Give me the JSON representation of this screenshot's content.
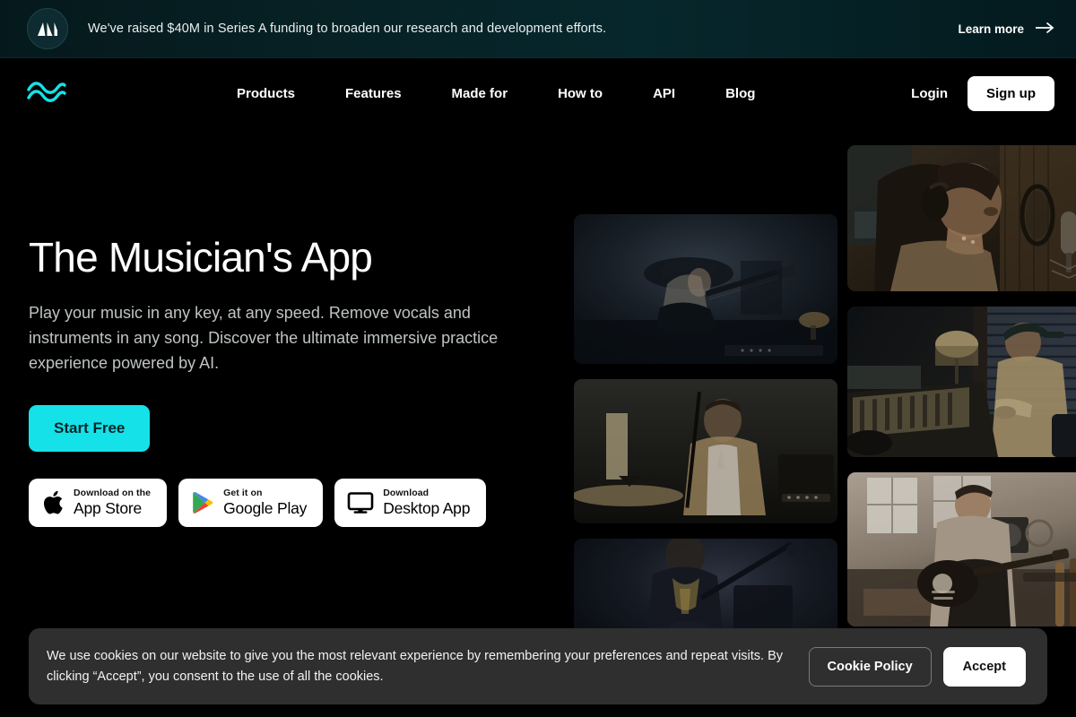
{
  "announcement": {
    "logo_icon": "mountain-monogram-logo-icon",
    "message": "We've raised $40M in Series A funding to broaden our research and development efforts.",
    "cta_label": "Learn more",
    "cta_icon": "arrow-right-icon",
    "bg_color": "#06272c"
  },
  "nav": {
    "logo_icon": "soundwave-logo-icon",
    "logo_color": "#15e2e8",
    "links": [
      {
        "label": "Products"
      },
      {
        "label": "Features"
      },
      {
        "label": "Made for"
      },
      {
        "label": "How to"
      },
      {
        "label": "API"
      },
      {
        "label": "Blog"
      }
    ],
    "login_label": "Login",
    "signup_label": "Sign up"
  },
  "hero": {
    "title": "The Musician's App",
    "subtitle": "Play your music in any key, at any speed. Remove vocals and instruments in any song. Discover the ultimate immersive practice experience powered by AI.",
    "cta_label": "Start Free",
    "cta_color": "#15e2e8",
    "stores": [
      {
        "icon": "apple-logo-icon",
        "top_label": "Download on the",
        "main_label": "App Store"
      },
      {
        "icon": "google-play-logo-icon",
        "top_label": "Get it on",
        "main_label": "Google Play"
      },
      {
        "icon": "desktop-monitor-icon",
        "top_label": "Download",
        "main_label": "Desktop App"
      }
    ]
  },
  "gallery": {
    "middle_column": [
      {
        "alt": "Guitarist wearing a hat playing electric guitar on a dark smoky stage"
      },
      {
        "alt": "Drummer in a tan jacket seated behind a cymbal in a dim studio"
      },
      {
        "alt": "Bassist lit from behind performing on a dark stage"
      }
    ],
    "right_column": [
      {
        "alt": "Singer wearing headphones at a studio condenser microphone"
      },
      {
        "alt": "Producer in a cap working at a large mixing console by a window"
      },
      {
        "alt": "Guitarist playing a black electric guitar in a bright home studio"
      }
    ]
  },
  "cookie_banner": {
    "text": "We use cookies on our website to give you the most relevant experience by remembering your preferences and repeat visits. By clicking “Accept”, you consent to the use of all the cookies.",
    "policy_label": "Cookie Policy",
    "accept_label": "Accept"
  }
}
